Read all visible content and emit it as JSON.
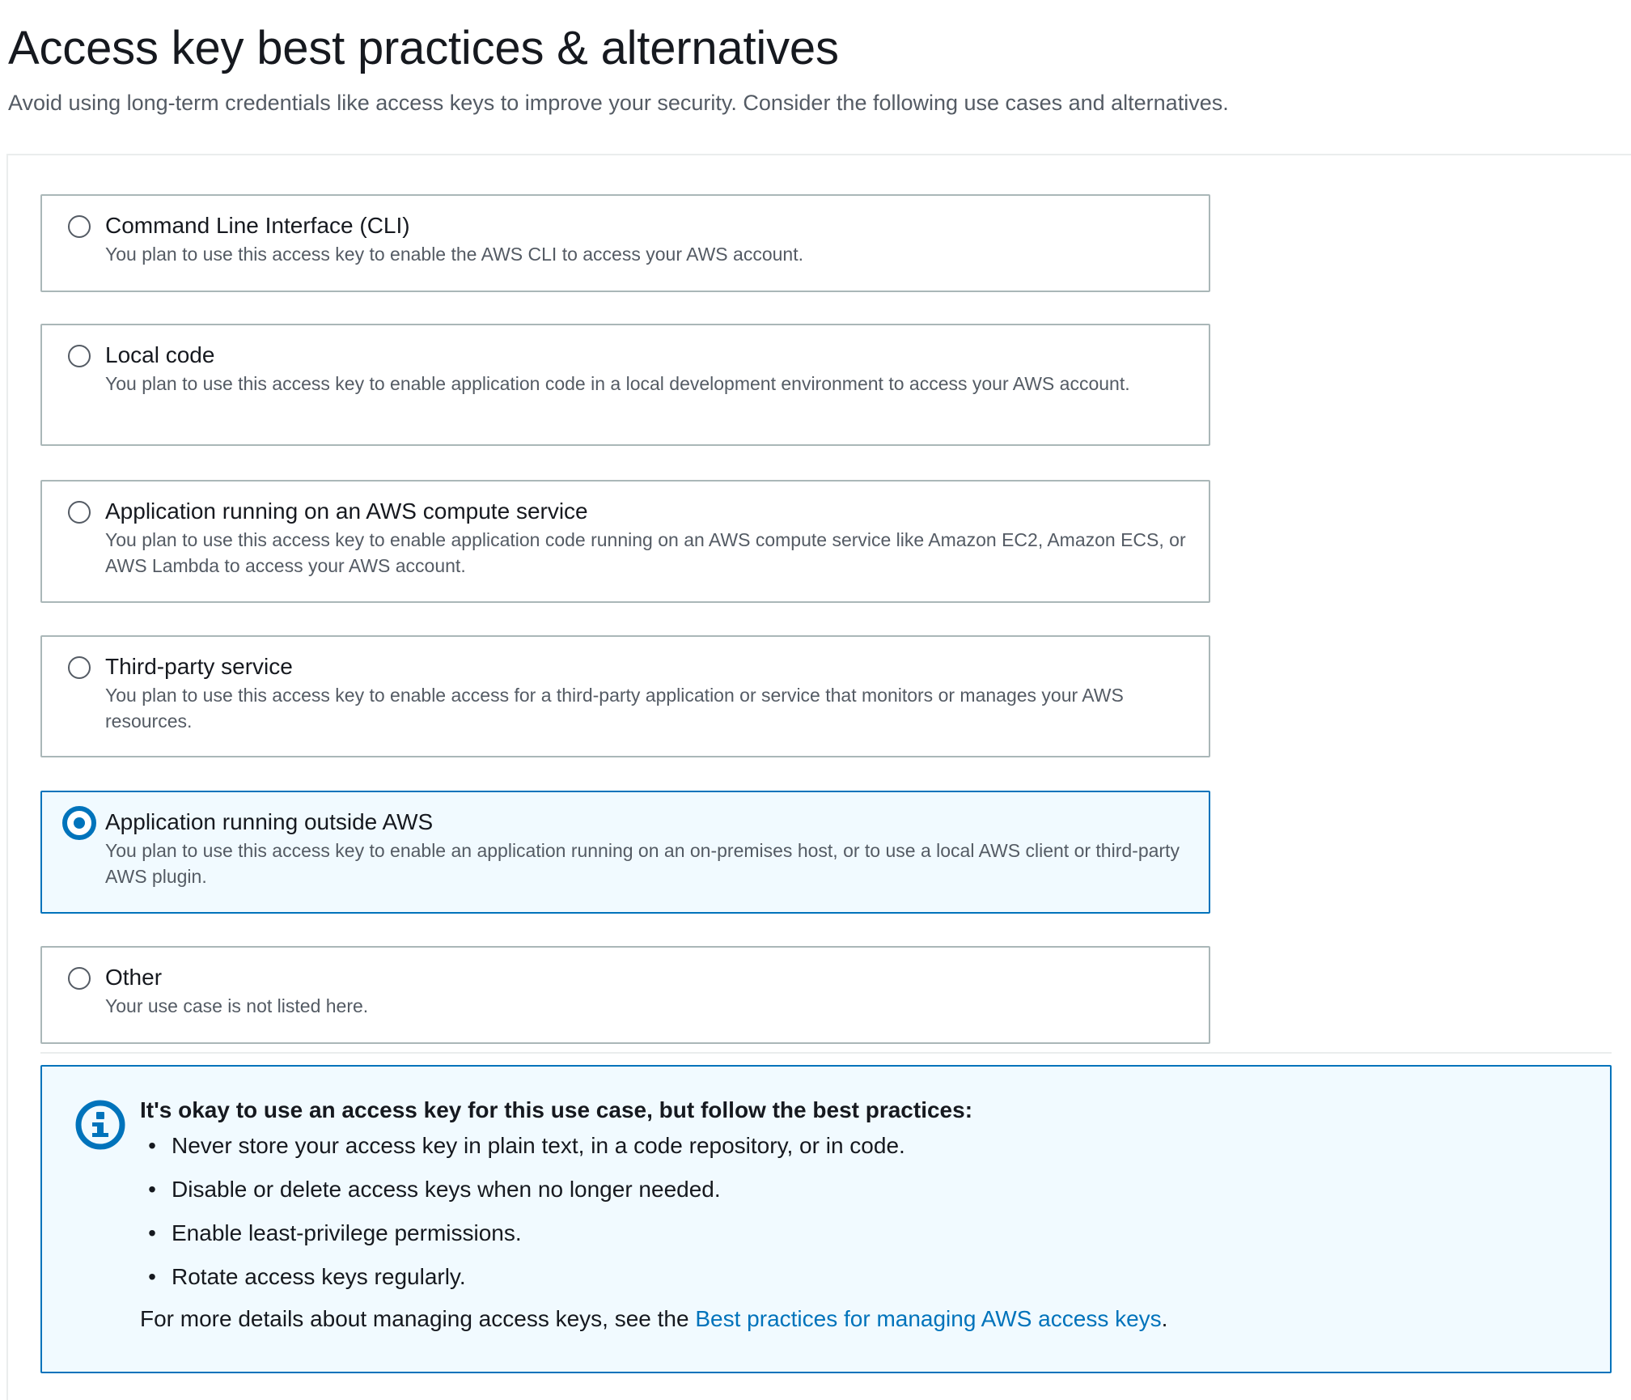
{
  "page": {
    "title": "Access key best practices & alternatives",
    "description": "Avoid using long-term credentials like access keys to improve your security. Consider the following use cases and alternatives."
  },
  "use_cases": [
    {
      "title": "Command Line Interface (CLI)",
      "description": "You plan to use this access key to enable the AWS CLI to access your AWS account.",
      "selected": false
    },
    {
      "title": "Local code",
      "description": "You plan to use this access key to enable application code in a local development environment to access your AWS account.",
      "selected": false
    },
    {
      "title": "Application running on an AWS compute service",
      "description": "You plan to use this access key to enable application code running on an AWS compute service like Amazon EC2, Amazon ECS, or AWS Lambda to access your AWS account.",
      "selected": false
    },
    {
      "title": "Third-party service",
      "description": "You plan to use this access key to enable access for a third-party application or service that monitors or manages your AWS resources.",
      "selected": false
    },
    {
      "title": "Application running outside AWS",
      "description": "You plan to use this access key to enable an application running on an on-premises host, or to use a local AWS client or third-party AWS plugin.",
      "selected": true
    },
    {
      "title": "Other",
      "description": "Your use case is not listed here.",
      "selected": false
    }
  ],
  "alert": {
    "icon": "info-icon",
    "heading": "It's okay to use an access key for this use case, but follow the best practices:",
    "bullets": [
      "Never store your access key in plain text, in a code repository, or in code.",
      "Disable or delete access keys when no longer needed.",
      "Enable least-privilege permissions.",
      "Rotate access keys regularly."
    ],
    "footer_prefix": "For more details about managing access keys, see the ",
    "footer_link": "Best practices for managing AWS access keys",
    "footer_suffix": "."
  },
  "colors": {
    "accent": "#0073bb",
    "selected_background": "#f1faff",
    "tile_border": "#aab7b8",
    "text_primary": "#16191f",
    "text_secondary": "#545b64"
  }
}
